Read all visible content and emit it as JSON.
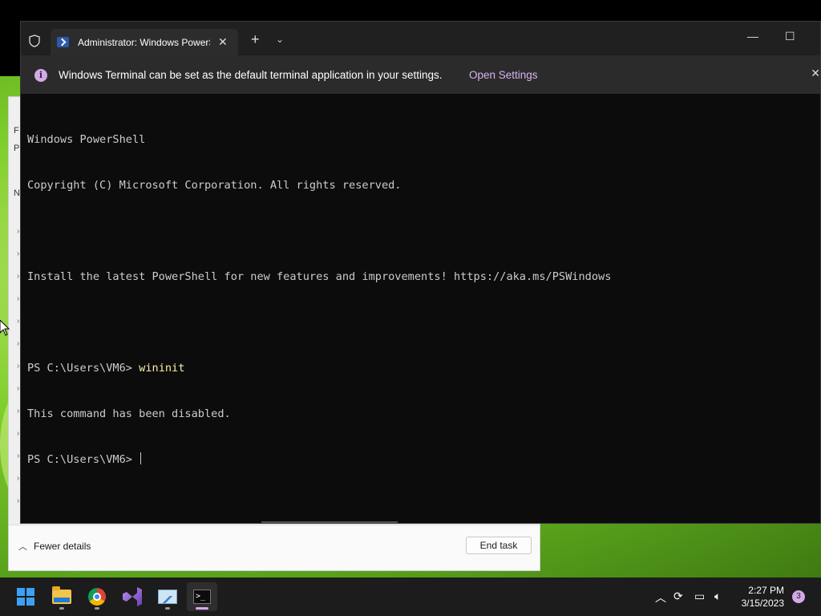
{
  "terminal": {
    "tab_title": "Administrator: Windows PowerShell",
    "new_tab_glyph": "+",
    "dropdown_glyph": "⌄",
    "infobar": {
      "message": "Windows Terminal can be set as the default terminal application in your settings.",
      "link": "Open Settings"
    },
    "console": {
      "line1": "Windows PowerShell",
      "line2": "Copyright (C) Microsoft Corporation. All rights reserved.",
      "line3": "Install the latest PowerShell for new features and improvements! https://aka.ms/PSWindows",
      "prompt1": "PS C:\\Users\\VM6> ",
      "command1": "wininit",
      "output1": "This command has been disabled.",
      "prompt2": "PS C:\\Users\\VM6> "
    }
  },
  "taskmgr": {
    "fewer_details": "Fewer details",
    "end_task": "End task",
    "side_letters": [
      "F",
      "P",
      "N"
    ]
  },
  "taskbar": {
    "apps": [
      "start-icon",
      "file-explorer-icon",
      "chrome-icon",
      "visual-studio-icon",
      "performance-monitor-icon",
      "terminal-icon"
    ],
    "time": "2:27 PM",
    "date": "3/15/2023",
    "notification_count": "3"
  },
  "colors": {
    "terminal_bg": "#0c0c0c",
    "titlebar_bg": "#202020",
    "accent_purple": "#d8b4f0",
    "command_yellow": "#f9f1a5",
    "taskbar_bg": "#1c1c1c"
  }
}
